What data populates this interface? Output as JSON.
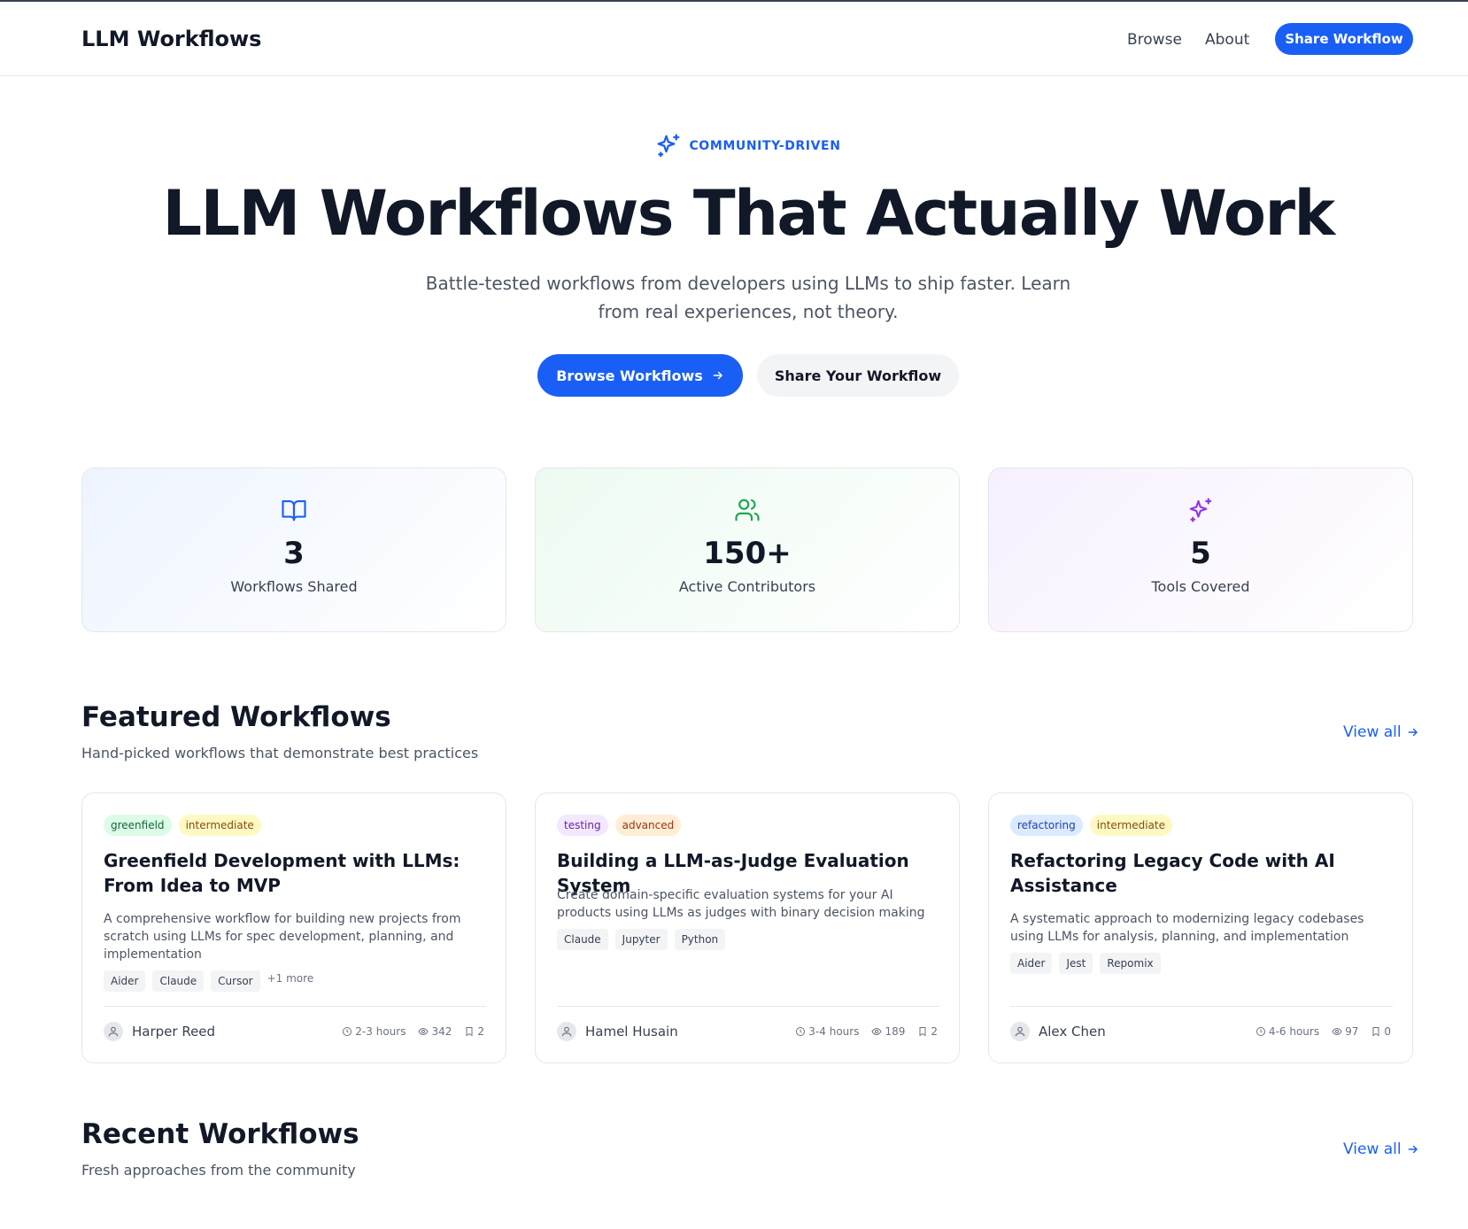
{
  "header": {
    "brand": "LLM Workflows",
    "nav": {
      "browse": "Browse",
      "about": "About"
    },
    "share_button": "Share Workflow"
  },
  "hero": {
    "badge": "COMMUNITY-DRIVEN",
    "title": "LLM Workflows That Actually Work",
    "subtitle": "Battle-tested workflows from developers using LLMs to ship faster. Learn from real experiences, not theory.",
    "primary_button": "Browse Workflows",
    "secondary_button": "Share Your Workflow"
  },
  "stats": [
    {
      "value": "3",
      "label": "Workflows Shared",
      "icon": "book-open-icon",
      "color": "#1a5ff5"
    },
    {
      "value": "150+",
      "label": "Active Contributors",
      "icon": "users-icon",
      "color": "#16a34a"
    },
    {
      "value": "5",
      "label": "Tools Covered",
      "icon": "sparkles-icon",
      "color": "#9333ea"
    }
  ],
  "featured": {
    "title": "Featured Workflows",
    "subtitle": "Hand-picked workflows that demonstrate best practices",
    "view_all": "View all",
    "cards": [
      {
        "tags": [
          "greenfield",
          "intermediate"
        ],
        "title": "Greenfield Development with LLMs: From Idea to MVP",
        "description": "A comprehensive workflow for building new projects from scratch using LLMs for spec development, planning, and implementation",
        "tools": [
          "Aider",
          "Claude",
          "Cursor"
        ],
        "more": "+1 more",
        "author": "Harper Reed",
        "duration": "2-3 hours",
        "views": "342",
        "saves": "2"
      },
      {
        "tags": [
          "testing",
          "advanced"
        ],
        "title": "Building a LLM-as-Judge Evaluation System",
        "description": "Create domain-specific evaluation systems for your AI products using LLMs as judges with binary decision making",
        "tools": [
          "Claude",
          "Jupyter",
          "Python"
        ],
        "author": "Hamel Husain",
        "duration": "3-4 hours",
        "views": "189",
        "saves": "2"
      },
      {
        "tags": [
          "refactoring",
          "intermediate"
        ],
        "title": "Refactoring Legacy Code with AI Assistance",
        "description": "A systematic approach to modernizing legacy codebases using LLMs for analysis, planning, and implementation",
        "tools": [
          "Aider",
          "Jest",
          "Repomix"
        ],
        "author": "Alex Chen",
        "duration": "4-6 hours",
        "views": "97",
        "saves": "0"
      }
    ]
  },
  "recent": {
    "title": "Recent Workflows",
    "subtitle": "Fresh approaches from the community",
    "view_all": "View all"
  },
  "colors": {
    "accent": "#1a5ff5",
    "text": "#111827",
    "muted": "#4b5563",
    "border": "#e5e7eb"
  }
}
